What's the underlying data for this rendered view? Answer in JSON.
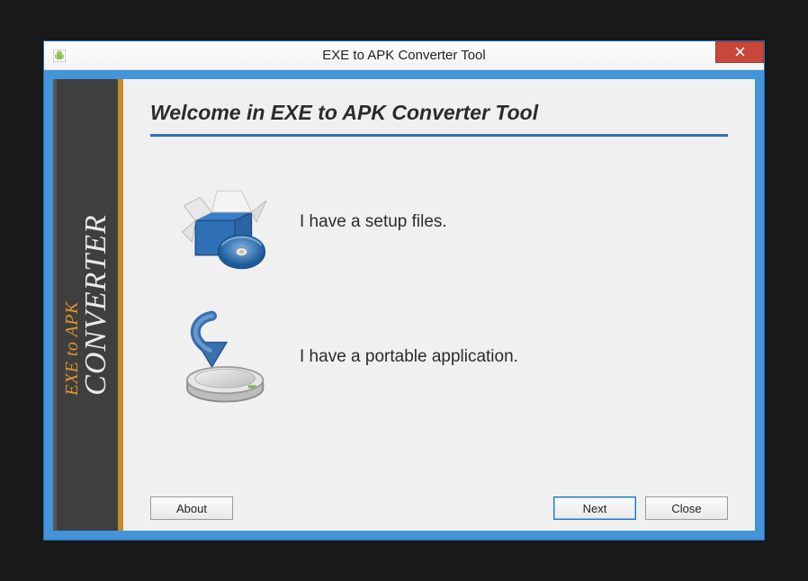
{
  "window": {
    "title": "EXE to APK Converter Tool"
  },
  "sidebar": {
    "line1": "EXE to APK",
    "line2": "CONVERTER"
  },
  "main": {
    "heading": "Welcome in EXE to APK Converter Tool",
    "option_setup": "I have a setup files.",
    "option_portable": "I have a portable application."
  },
  "footer": {
    "about": "About",
    "next": "Next",
    "close": "Close"
  }
}
